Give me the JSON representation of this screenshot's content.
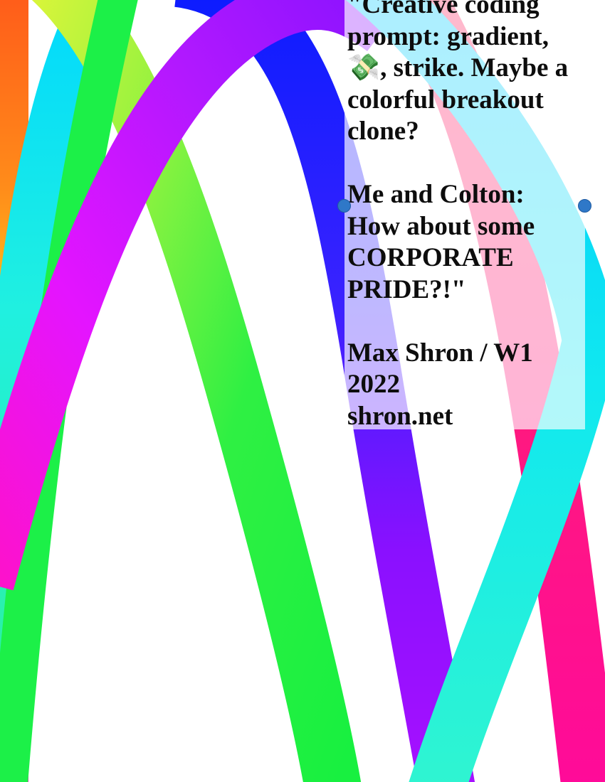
{
  "caption": {
    "lines": [
      "\"Creative coding",
      "prompt: gradient,",
      "💸, strike. Maybe a",
      "colorful breakout",
      "clone?",
      "",
      "Me and Colton:",
      "How about some",
      "CORPORATE",
      "PRIDE?!\"",
      "",
      "Max Shron / W1",
      "2022",
      "shron.net"
    ]
  },
  "artwork": {
    "description_colors": {
      "arc_violet_magenta": [
        "#ff10d8",
        "#b216ff",
        "#8a0cff"
      ],
      "arc_green": [
        "#18f040",
        "#9cf53a",
        "#e6f532"
      ],
      "arc_blue": [
        "#0a1cff",
        "#3a2aff",
        "#9a10ff"
      ],
      "arc_cyan": [
        "#00e6ff",
        "#20f0c8",
        "#40ffd8"
      ],
      "arc_pink": [
        "#ff2a72",
        "#ff0a9a"
      ],
      "left_gradient": [
        "#ff5a1a",
        "#ffd21a",
        "#ff2ab0"
      ]
    }
  }
}
